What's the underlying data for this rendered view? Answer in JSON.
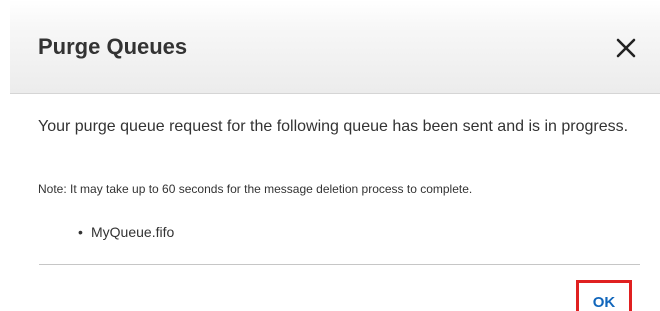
{
  "dialog": {
    "title": "Purge Queues",
    "close_icon": "close-icon",
    "message": "Your purge queue request for the following queue has been sent and is in progress.",
    "note": "Note: It may take up to 60 seconds for the message deletion process to complete.",
    "queues": [
      "MyQueue.fifo"
    ],
    "bullet": "•",
    "ok_label": "OK"
  },
  "colors": {
    "ok_text": "#1166bb",
    "highlight_border": "#e02020",
    "title_text": "#333333"
  }
}
